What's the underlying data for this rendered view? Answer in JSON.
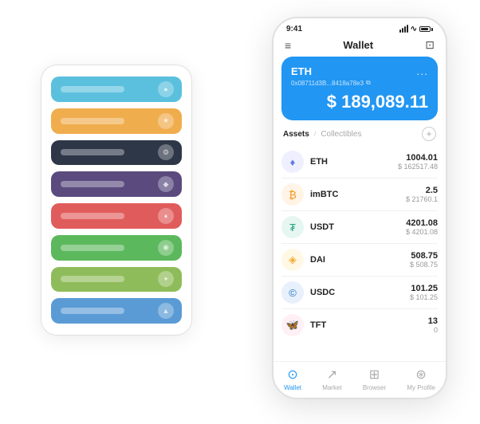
{
  "scene": {
    "back_panel": {
      "rows": [
        {
          "color": "#5bc0de",
          "label": ""
        },
        {
          "color": "#f0ad4e",
          "label": ""
        },
        {
          "color": "#2d3748",
          "label": ""
        },
        {
          "color": "#5a4a7e",
          "label": ""
        },
        {
          "color": "#e05c5c",
          "label": ""
        },
        {
          "color": "#5cb85c",
          "label": ""
        },
        {
          "color": "#8fbc5a",
          "label": ""
        },
        {
          "color": "#5b9bd5",
          "label": ""
        }
      ]
    }
  },
  "phone": {
    "status_bar": {
      "time": "9:41",
      "signal": "signal",
      "wifi": "wifi",
      "battery": "battery"
    },
    "header": {
      "menu_icon": "≡",
      "title": "Wallet",
      "scan_icon": "⊡"
    },
    "eth_card": {
      "title": "ETH",
      "dots": "...",
      "address": "0x08711d3B...8418a78e3",
      "copy_icon": "⧉",
      "amount": "$ 189,089.11"
    },
    "assets": {
      "tab_active": "Assets",
      "tab_separator": "/",
      "tab_inactive": "Collectibles",
      "add_icon": "+"
    },
    "asset_list": [
      {
        "icon": "♦",
        "icon_color": "#627eea",
        "icon_bg": "#eef0ff",
        "name": "ETH",
        "amount": "1004.01",
        "usd": "$ 162517.48"
      },
      {
        "icon": "₿",
        "icon_color": "#f7931a",
        "icon_bg": "#fff4e5",
        "name": "imBTC",
        "amount": "2.5",
        "usd": "$ 21760.1"
      },
      {
        "icon": "₮",
        "icon_color": "#26a17b",
        "icon_bg": "#e6f7f2",
        "name": "USDT",
        "amount": "4201.08",
        "usd": "$ 4201.08"
      },
      {
        "icon": "◈",
        "icon_color": "#f5ac37",
        "icon_bg": "#fff8e5",
        "name": "DAI",
        "amount": "508.75",
        "usd": "$ 508.75"
      },
      {
        "icon": "©",
        "icon_color": "#2775ca",
        "icon_bg": "#e8f0fb",
        "name": "USDC",
        "amount": "101.25",
        "usd": "$ 101.25"
      },
      {
        "icon": "🦋",
        "icon_color": "#ff6b9d",
        "icon_bg": "#fff0f6",
        "name": "TFT",
        "amount": "13",
        "usd": "0"
      }
    ],
    "bottom_nav": [
      {
        "label": "Wallet",
        "icon": "⊙",
        "active": true
      },
      {
        "label": "Market",
        "icon": "📈",
        "active": false
      },
      {
        "label": "Browser",
        "icon": "🌐",
        "active": false
      },
      {
        "label": "My Profile",
        "icon": "👤",
        "active": false
      }
    ]
  }
}
